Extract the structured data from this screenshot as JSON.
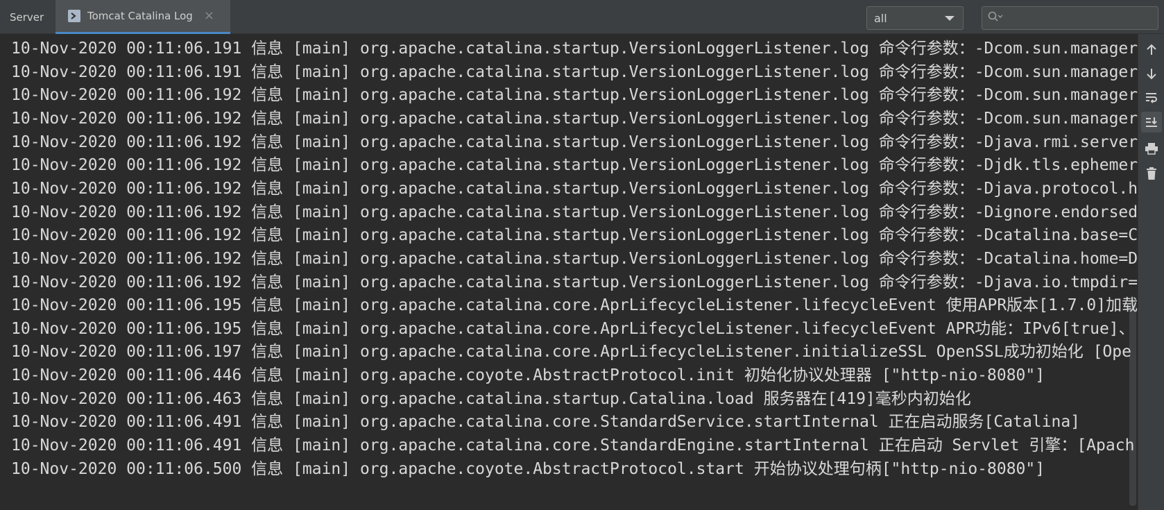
{
  "tabs": [
    {
      "label": "Server"
    },
    {
      "label": "Tomcat Catalina Log",
      "close": "×"
    }
  ],
  "filter": {
    "level": "all",
    "search_value": ""
  },
  "toolbar_icons": [
    "scroll-up-arrow-icon",
    "scroll-down-arrow-icon",
    "soft-wrap-icon",
    "scroll-to-end-icon",
    "print-icon",
    "trash-icon"
  ],
  "log_lines": [
    "10-Nov-2020 00:11:06.191 信息 [main] org.apache.catalina.startup.VersionLoggerListener.log 命令行参数：-Dcom.sun.manager",
    "10-Nov-2020 00:11:06.191 信息 [main] org.apache.catalina.startup.VersionLoggerListener.log 命令行参数：-Dcom.sun.manager",
    "10-Nov-2020 00:11:06.192 信息 [main] org.apache.catalina.startup.VersionLoggerListener.log 命令行参数：-Dcom.sun.manager",
    "10-Nov-2020 00:11:06.192 信息 [main] org.apache.catalina.startup.VersionLoggerListener.log 命令行参数：-Dcom.sun.manager",
    "10-Nov-2020 00:11:06.192 信息 [main] org.apache.catalina.startup.VersionLoggerListener.log 命令行参数：-Djava.rmi.server",
    "10-Nov-2020 00:11:06.192 信息 [main] org.apache.catalina.startup.VersionLoggerListener.log 命令行参数：-Djdk.tls.ephemer",
    "10-Nov-2020 00:11:06.192 信息 [main] org.apache.catalina.startup.VersionLoggerListener.log 命令行参数：-Djava.protocol.h",
    "10-Nov-2020 00:11:06.192 信息 [main] org.apache.catalina.startup.VersionLoggerListener.log 命令行参数：-Dignore.endorsed",
    "10-Nov-2020 00:11:06.192 信息 [main] org.apache.catalina.startup.VersionLoggerListener.log 命令行参数：-Dcatalina.base=C",
    "10-Nov-2020 00:11:06.192 信息 [main] org.apache.catalina.startup.VersionLoggerListener.log 命令行参数：-Dcatalina.home=D",
    "10-Nov-2020 00:11:06.192 信息 [main] org.apache.catalina.startup.VersionLoggerListener.log 命令行参数：-Djava.io.tmpdir=",
    "10-Nov-2020 00:11:06.195 信息 [main] org.apache.catalina.core.AprLifecycleListener.lifecycleEvent 使用APR版本[1.7.0]加载",
    "10-Nov-2020 00:11:06.195 信息 [main] org.apache.catalina.core.AprLifecycleListener.lifecycleEvent APR功能：IPv6[true]、",
    "10-Nov-2020 00:11:06.197 信息 [main] org.apache.catalina.core.AprLifecycleListener.initializeSSL OpenSSL成功初始化 [Ope",
    "10-Nov-2020 00:11:06.446 信息 [main] org.apache.coyote.AbstractProtocol.init 初始化协议处理器 [\"http-nio-8080\"]",
    "10-Nov-2020 00:11:06.463 信息 [main] org.apache.catalina.startup.Catalina.load 服务器在[419]毫秒内初始化",
    "10-Nov-2020 00:11:06.491 信息 [main] org.apache.catalina.core.StandardService.startInternal 正在启动服务[Catalina]",
    "10-Nov-2020 00:11:06.491 信息 [main] org.apache.catalina.core.StandardEngine.startInternal 正在启动 Servlet 引擎：[Apach",
    "10-Nov-2020 00:11:06.500 信息 [main] org.apache.coyote.AbstractProtocol.start 开始协议处理句柄[\"http-nio-8080\"]"
  ]
}
